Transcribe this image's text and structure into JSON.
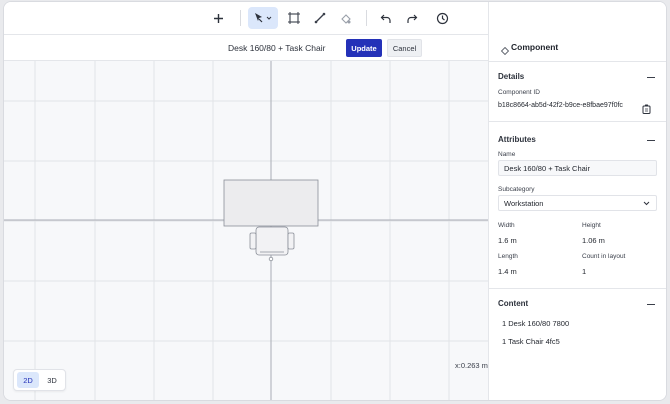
{
  "toolbar": {
    "tools": [
      {
        "icon": "plus-icon"
      },
      {
        "icon": "select-cursor-icon"
      },
      {
        "icon": "area-frame-icon"
      },
      {
        "icon": "measure-ruler-icon"
      },
      {
        "icon": "paint-fill-icon"
      },
      {
        "icon": "undo-icon"
      },
      {
        "icon": "redo-icon"
      },
      {
        "icon": "history-icon"
      }
    ]
  },
  "editor": {
    "component_title": "Desk 160/80 + Task Chair",
    "update_label": "Update",
    "cancel_label": "Cancel",
    "coordinate_readout": "x:0.263 m",
    "view_modes": [
      "2D",
      "3D"
    ],
    "active_view": "2D"
  },
  "panel": {
    "title": "Component",
    "details": {
      "heading": "Details",
      "id_label": "Component ID",
      "id_value": "b18c8664-ab5d-42f2-b9ce-e8fbae97f0fc"
    },
    "attributes": {
      "heading": "Attributes",
      "name_label": "Name",
      "name_value": "Desk 160/80 + Task Chair",
      "subcategory_label": "Subcategory",
      "subcategory_value": "Workstation",
      "width_label": "Width",
      "width_value": "1.6 m",
      "height_label": "Height",
      "height_value": "1.06 m",
      "length_label": "Length",
      "length_value": "1.4 m",
      "count_label": "Count in layout",
      "count_value": "1"
    },
    "content": {
      "heading": "Content",
      "items": [
        "1 Desk 160/80 7800",
        "1 Task Chair 4fc5"
      ]
    }
  },
  "colors": {
    "accent": "#2431b8",
    "active_tool_bg": "#dbe7fb",
    "grid_line": "#e2e4e8",
    "axis_line": "#a9adb5"
  }
}
